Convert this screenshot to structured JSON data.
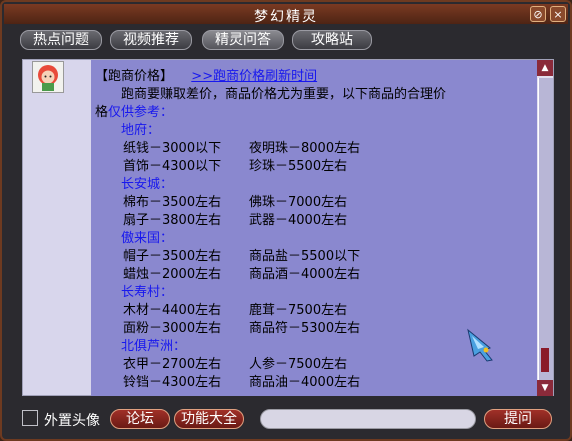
{
  "window": {
    "title": "梦幻精灵",
    "help_glyph": "⊘",
    "close_glyph": "×"
  },
  "tabs": [
    {
      "label": "热点问题"
    },
    {
      "label": "视频推荐"
    },
    {
      "label": "精灵问答"
    },
    {
      "label": "攻略站"
    }
  ],
  "answer": {
    "heading": "【跑商价格】",
    "refresh_link": ">>跑商价格刷新时间",
    "intro_line1": "跑商要赚取差价，商品价格尤为重要，以下商品的合理价",
    "intro_line2_prefix": "格",
    "intro_line2_suffix": "仅供参考：",
    "regions": [
      {
        "name": "地府：",
        "items": [
          [
            "纸钱－3000以下",
            "夜明珠－8000左右"
          ],
          [
            "首饰－4300以下",
            "珍珠－5500左右"
          ]
        ]
      },
      {
        "name": "长安城：",
        "items": [
          [
            "棉布－3500左右",
            "佛珠－7000左右"
          ],
          [
            "扇子－3800左右",
            "武器－4000左右"
          ]
        ]
      },
      {
        "name": "傲来国：",
        "items": [
          [
            "帽子－3500左右",
            "商品盐－5500以下"
          ],
          [
            "蜡烛－2000左右",
            "商品酒－4000左右"
          ]
        ]
      },
      {
        "name": "长寿村：",
        "items": [
          [
            "木材－4400左右",
            "鹿茸－7500左右"
          ],
          [
            "面粉－3000左右",
            "商品符－5300左右"
          ]
        ]
      },
      {
        "name": "北俱芦洲：",
        "items": [
          [
            "衣甲－2700左右",
            "人参－7500左右"
          ],
          [
            "铃铛－4300左右",
            "商品油－4000左右"
          ]
        ]
      }
    ]
  },
  "bottom": {
    "avatar_checkbox_label": "外置头像",
    "forum_button": "论坛",
    "functions_button": "功能大全",
    "ask_input_value": "",
    "ask_button": "提问"
  }
}
